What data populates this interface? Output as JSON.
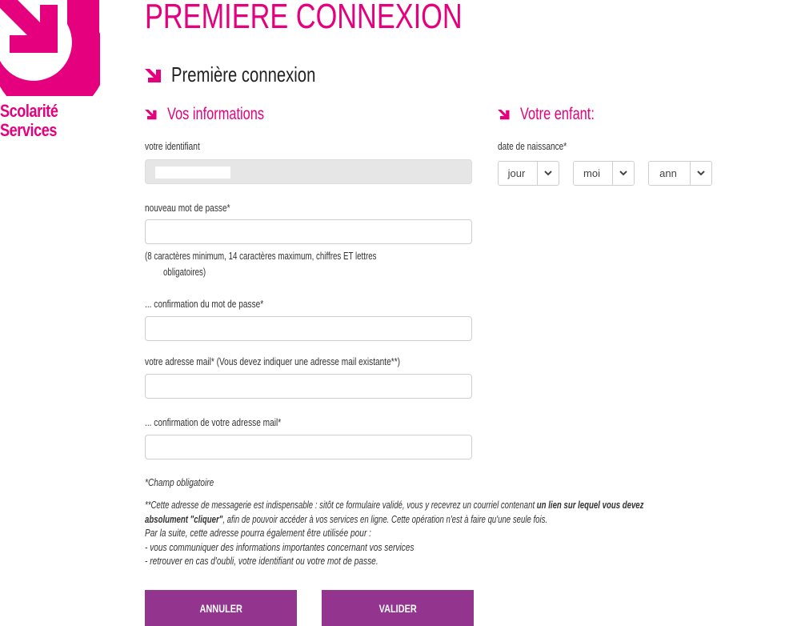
{
  "logo": {
    "line1": "Scolarité",
    "line2": "Services"
  },
  "page_title": "PREMIERE CONNEXION",
  "section_title": "Première connexion",
  "left_heading": "Vos informations",
  "right_heading": "Votre enfant:",
  "fields": {
    "identifiant": {
      "label": "votre identifiant",
      "value": ""
    },
    "password": {
      "label": "nouveau mot de passe*",
      "value": "",
      "help_line1": "(8 caractères minimum, 14 caractères maximum, chiffres ET lettres",
      "help_line2": "obligatoires)"
    },
    "password_confirm": {
      "label": "... confirmation du mot de passe*",
      "value": ""
    },
    "email": {
      "label": "votre adresse mail* (Vous devez indiquer une adresse mail existante**)",
      "value": ""
    },
    "email_confirm": {
      "label": "... confirmation de votre adresse mail*",
      "value": ""
    }
  },
  "birth_date": {
    "label": "date de naissance*",
    "day": "jour",
    "month": "moi",
    "year": "ann"
  },
  "notes": {
    "required": "*Champ obligatoire",
    "p1_a": "**Cette adresse de messagerie est indispensable : sitôt ce formulaire validé, vous y recevrez un courriel contenant ",
    "p1_b": "un lien sur lequel vous devez",
    "p2_a": "absolument \"cliquer\"",
    "p2_b": ", afin de pouvoir accéder à vos services en ligne. Cette opération n'est à faire qu'une seule fois.",
    "p3": "Par la suite, cette adresse pourra également être utilisée pour :",
    "p4": " - vous communiquer des informations importantes concernant vos services",
    "p5": " - retrouver en cas d'oubli, votre identifiant ou votre mot de passe."
  },
  "buttons": {
    "cancel": "ANNULER",
    "submit": "VALIDER"
  },
  "colors": {
    "accent": "#e5007d",
    "button": "#93358f"
  }
}
